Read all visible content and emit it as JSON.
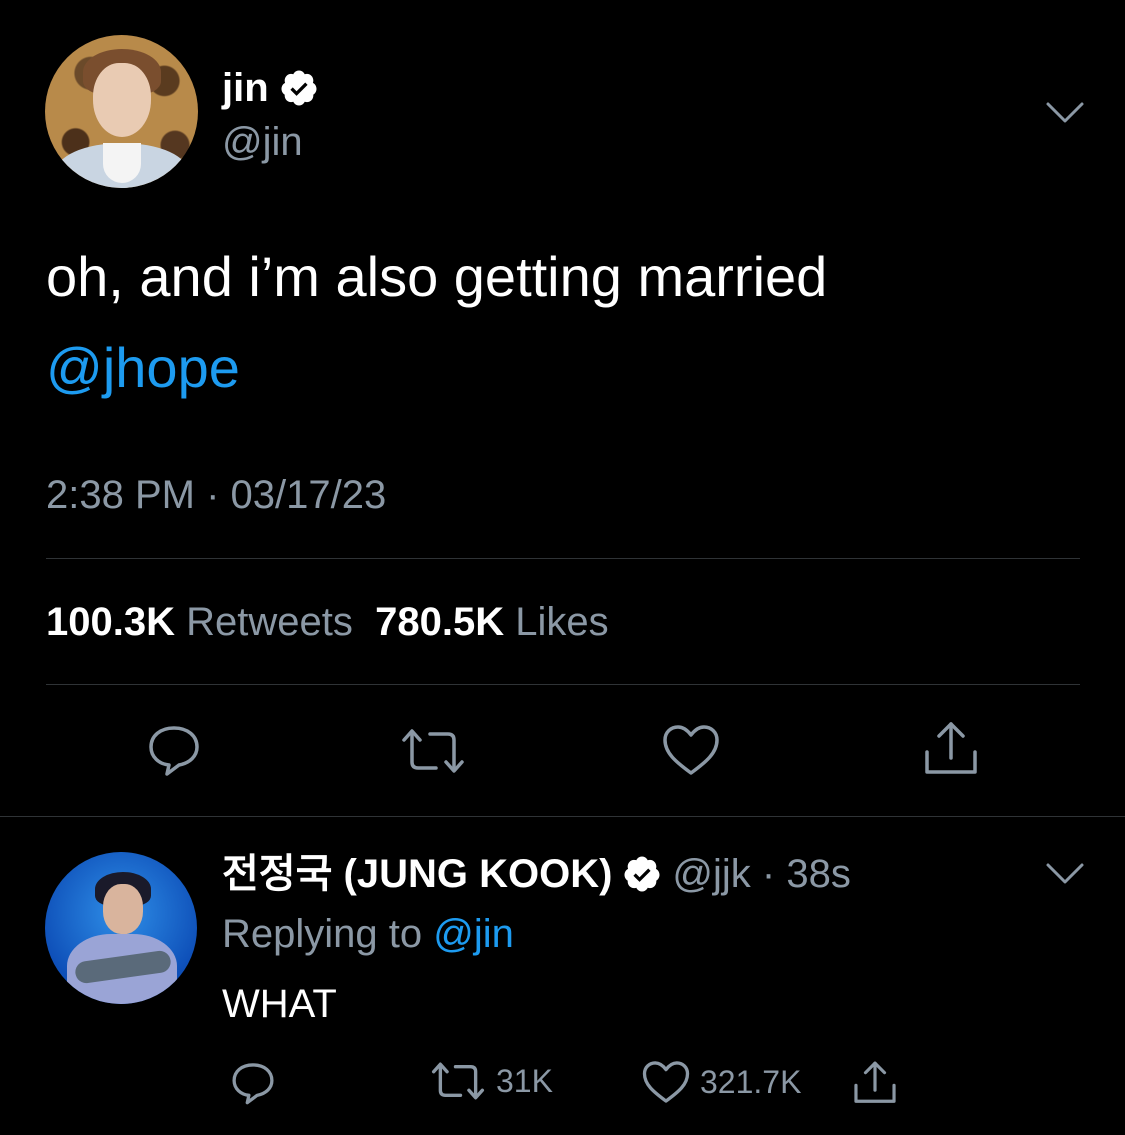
{
  "tweet": {
    "display_name": "jin",
    "handle": "@jin",
    "text": "oh, and i’m also getting married",
    "mention": "@jhope",
    "timestamp": "2:38 PM · 03/17/23",
    "retweets_count": "100.3K",
    "retweets_label": "Retweets",
    "likes_count": "780.5K",
    "likes_label": "Likes"
  },
  "reply": {
    "display_name": "전정국 (JUNG KOOK)",
    "handle_time": "@jjk · 38s",
    "replying_prefix": "Replying to",
    "replying_to": "@jin",
    "text": "WHAT",
    "retweets": "31K",
    "likes": "321.7K"
  },
  "colors": {
    "background": "#000000",
    "text": "#ffffff",
    "secondary": "#8b98a5",
    "link": "#1d9bf0",
    "divider": "#2f3336"
  },
  "icons": [
    "verified-badge-icon",
    "chevron-down-icon",
    "reply-icon",
    "retweet-icon",
    "like-icon",
    "share-icon"
  ]
}
